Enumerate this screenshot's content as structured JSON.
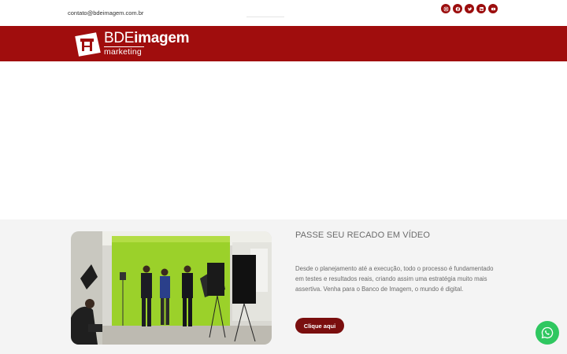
{
  "topbar": {
    "email": "contato@bdeimagem.com.br",
    "social_icons": [
      "instagram-icon",
      "facebook-icon",
      "twitter-icon",
      "linkedin-icon",
      "youtube-icon"
    ]
  },
  "header": {
    "brand_main_1": "BDE",
    "brand_main_2": "imagem",
    "brand_sub": "marketing"
  },
  "section": {
    "title": "PASSE SEU RECADO EM VÍDEO",
    "text": "Desde o planejamento até a execução, todo o processo é fundamentado em testes e resultados reais, criando assim uma estratégia muito mais assertiva. Venha para o Banco de Imagem, o mundo é digital.",
    "cta_label": "Clique aqui"
  },
  "colors": {
    "header_red": "#a00d0d",
    "button_red": "#7a0e0e",
    "whatsapp_green": "#2fc760"
  }
}
